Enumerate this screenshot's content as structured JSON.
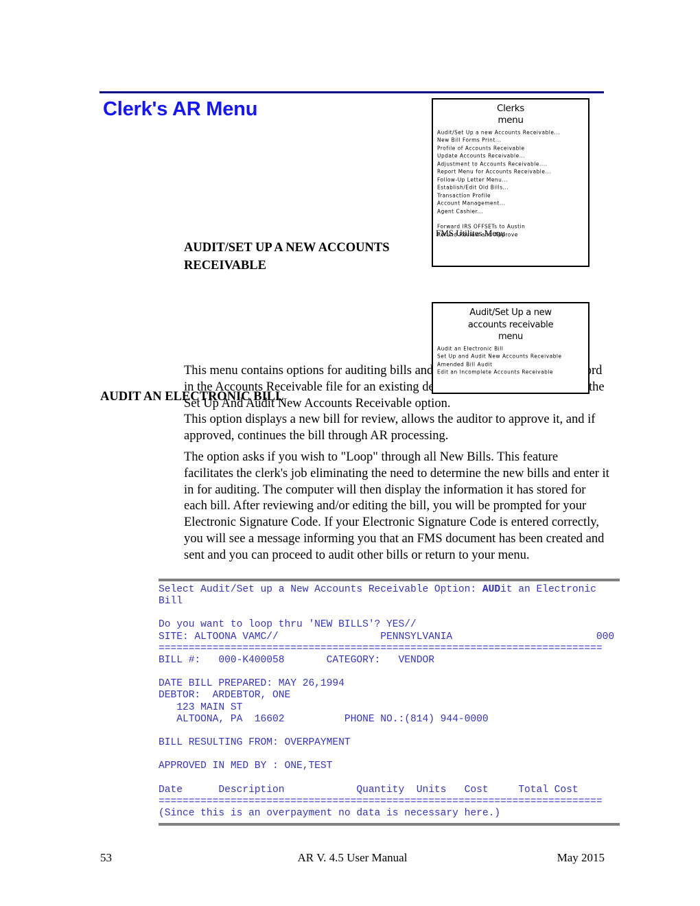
{
  "document": {
    "title": "Clerk's AR Menu",
    "header_rule_color": "#000080",
    "title_color": "#1414ff",
    "terminal_text_color": "#3333cc"
  },
  "menu_box_one": {
    "title_line1": "Clerks",
    "title_line2": "menu",
    "items": [
      "Audit/Set Up a new  Accounts Receivable...",
      "New  Bill Forms Print...",
      "Profile of Accounts Receivable",
      "Update Accounts Receivable...",
      "Adjustment to Accounts Receivable....",
      "Report Menu for Accounts Receivable...",
      "Follow-Up Letter Menu...",
      "Establish/Edit Old Bills...",
      "Transaction Profile",
      "Account Management...",
      "Agent Cashier...",
      "",
      "Forward IRS OFFSETs to Austin",
      "Refund Review and Approve"
    ],
    "overlap_text": "FMS Utilites Menu"
  },
  "menu_box_two": {
    "title_line1": "Audit/Set Up a new",
    "title_line2": "accounts receivable",
    "title_line3": "menu",
    "items": [
      "Audit an Electronic Bill",
      "Set Up and Audit New  Accounts Receivable",
      "Amended Bill Audit",
      "Edit an Incomplete Accounts Receivable"
    ]
  },
  "sections": {
    "heading_audit_setup": "AUDIT/SET UP A NEW ACCOUNTS RECEIVABLE",
    "para_menu_contains": "This menu contains options  for auditing bills and establishing a new billing record in the Accounts Receivable file for an existing debtor.  To add a new debtor, see the Set Up And Audit New Accounts Receivable option.",
    "heading_electronic_bill": "AUDIT AN ELECTRONIC BILL",
    "para_displays": "This option displays a new bill for review, allows the auditor to approve it, and if approved, continues the bill through AR processing.",
    "para_loop": "The option asks if you wish to \"Loop\" through all New Bills.  This feature facilitates the clerk's job eliminating the need to determine the new bills and enter it in for auditing.  The computer will then display the information it has stored for each bill.  After reviewing and/or editing the bill, you will be prompted for your Electronic Signature Code.  If your Electronic Signature Code is entered correctly, you will see a message informing you that an FMS document has been created and sent and you can proceed to audit other bills or return to your menu."
  },
  "terminal": {
    "line_select_prefix": "Select Audit/Set up a New Accounts Receivable Option: ",
    "line_select_bold": "AUD",
    "line_select_suffix": "it an Electronic",
    "line_select_wrap": "Bill",
    "line_loop": "Do you want to loop thru 'NEW BILLS'? YES//",
    "line_site": "SITE: ALTOONA VAMC//                 PENNSYLVANIA                        000",
    "separator": "==========================================================================",
    "line_bill": "BILL #:   000-K400058       CATEGORY:   VENDOR",
    "line_date_prepared": "DATE BILL PREPARED: MAY 26,1994",
    "line_debtor": "DEBTOR:  ARDEBTOR, ONE",
    "line_address1": "   123 MAIN ST",
    "line_address2": "   ALTOONA, PA  16602          PHONE NO.:(814) 944-0000",
    "line_resulting": "BILL RESULTING FROM: OVERPAYMENT",
    "line_approved": "APPROVED IN MED BY : ONE,TEST",
    "line_table_header": "Date      Description            Quantity  Units   Cost     Total Cost",
    "line_note": "(Since this is an overpayment no data is necessary here.)"
  },
  "footer": {
    "page_number": "53",
    "center": "AR V. 4.5  User Manual",
    "date": "May 2015"
  }
}
